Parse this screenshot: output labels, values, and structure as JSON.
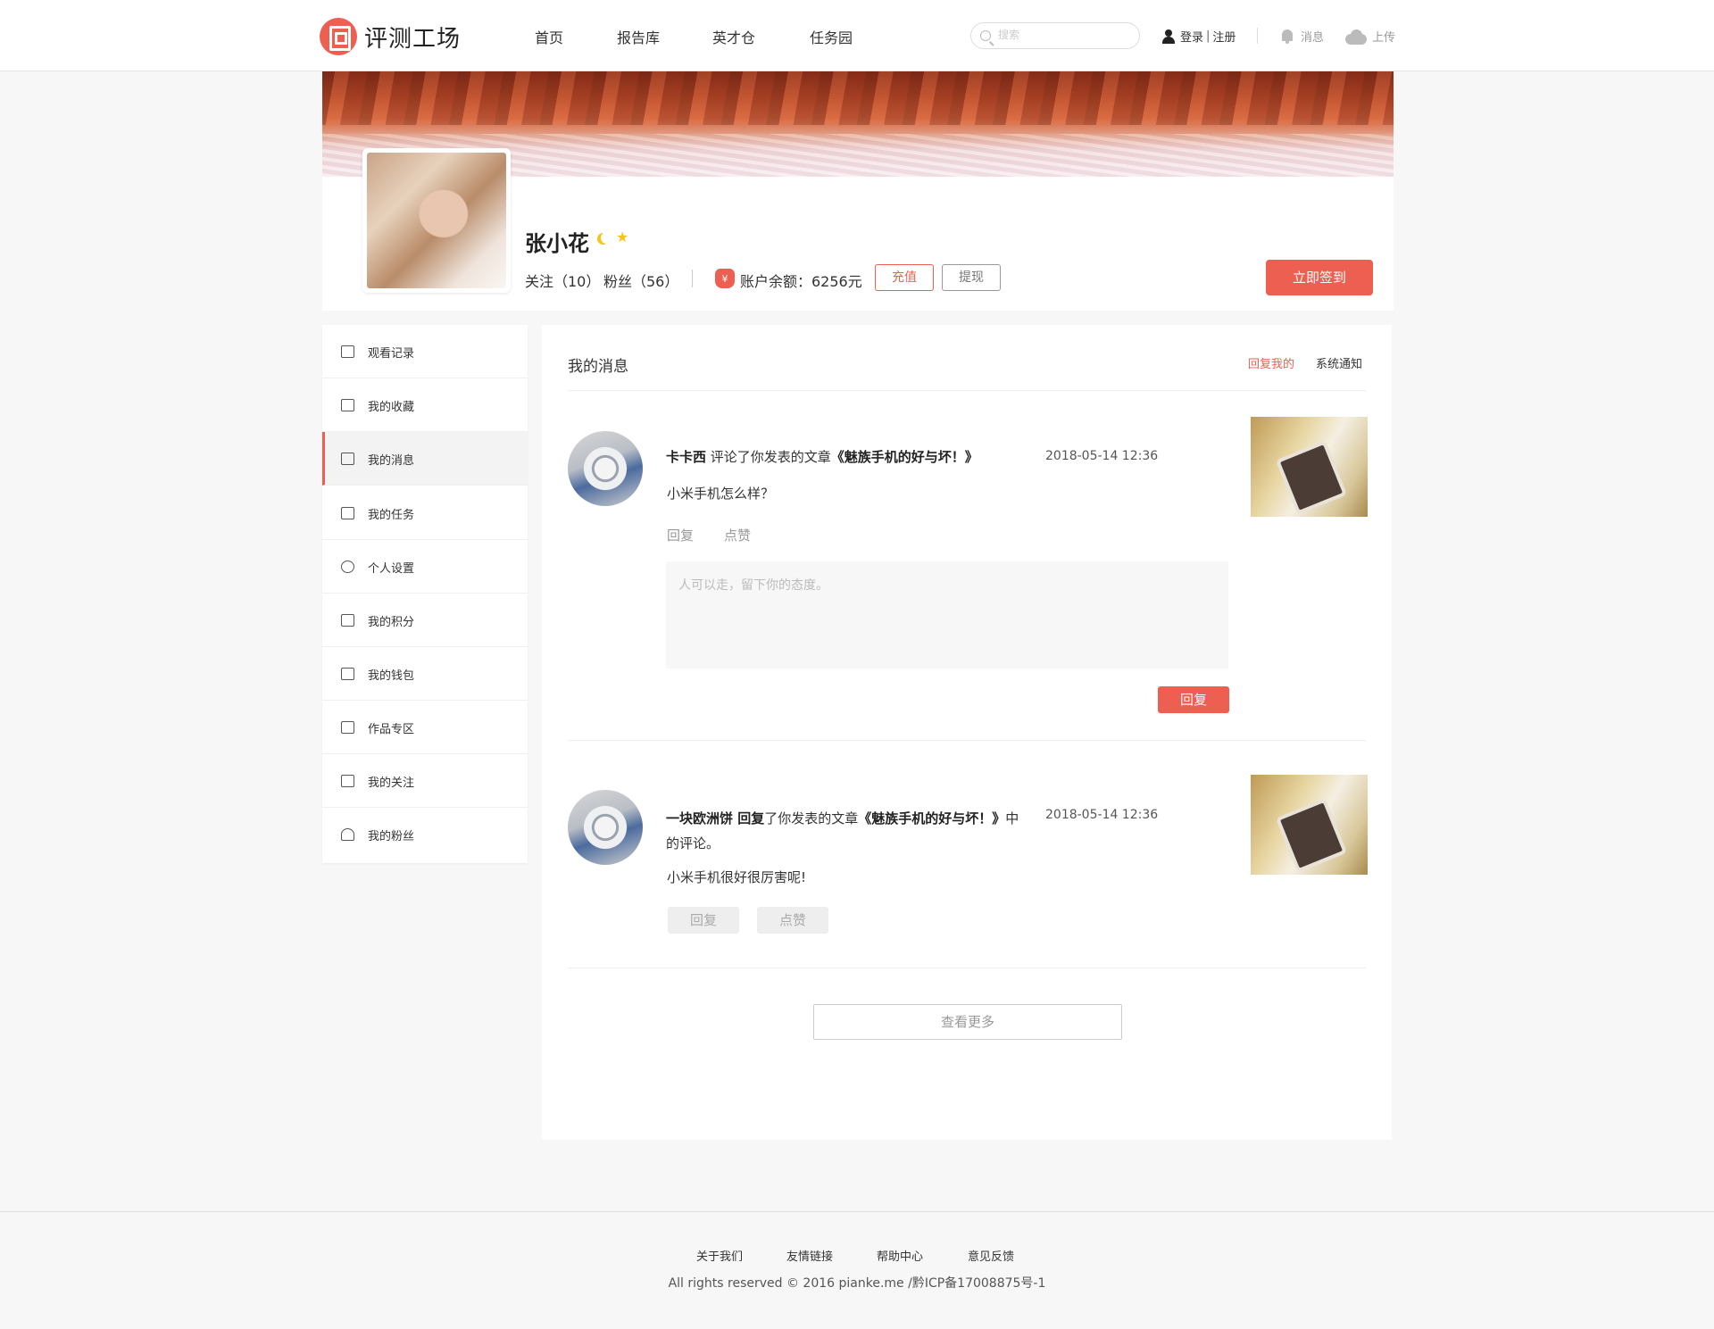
{
  "header": {
    "logo_text": "评测工场",
    "nav": [
      "首页",
      "报告库",
      "英才仓",
      "任务园"
    ],
    "search_placeholder": "搜索",
    "login": "登录",
    "register": "注册",
    "login_sep": "|",
    "messages": "消息",
    "upload": "上传"
  },
  "profile": {
    "name": "张小花",
    "following": "关注（10）",
    "fans": "粉丝（56）",
    "balance": "账户余额：6256元",
    "bag_symbol": "¥",
    "recharge": "充值",
    "withdraw": "提现",
    "checkin": "立即签到"
  },
  "sidebar": {
    "items": [
      {
        "label": "观看记录",
        "icon": "play-record-icon"
      },
      {
        "label": "我的收藏",
        "icon": "favorite-icon"
      },
      {
        "label": "我的消息",
        "icon": "message-icon"
      },
      {
        "label": "我的任务",
        "icon": "task-icon"
      },
      {
        "label": "个人设置",
        "icon": "settings-icon"
      },
      {
        "label": "我的积分",
        "icon": "points-icon"
      },
      {
        "label": "我的钱包",
        "icon": "wallet-icon"
      },
      {
        "label": "作品专区",
        "icon": "works-icon"
      },
      {
        "label": "我的关注",
        "icon": "follow-icon"
      },
      {
        "label": "我的粉丝",
        "icon": "fans-icon"
      }
    ],
    "active_index": 2
  },
  "main": {
    "title": "我的消息",
    "tabs": {
      "reply": "回复我的",
      "notice": "系统通知"
    },
    "messages": [
      {
        "author": "卡卡西",
        "action": " 评论了你发表的文章",
        "article": "《魅族手机的好与坏！》",
        "time": "2018-05-14 12:36",
        "body": "小米手机怎么样？",
        "reply_link": "回复",
        "like_link": "点赞",
        "reply_placeholder": "人可以走，留下你的态度。",
        "reply_button": "回复"
      },
      {
        "author": "一块欧洲饼 回复",
        "action": "了你发表的文章",
        "article": "《魅族手机的好与坏！》",
        "action2": "中的评论。",
        "time": "2018-05-14 12:36",
        "body": "小米手机很好很厉害呢!",
        "reply_button": "回复",
        "like_button": "点赞"
      }
    ],
    "more": "查看更多"
  },
  "footer": {
    "links": [
      "关于我们",
      "友情链接",
      "帮助中心",
      "意见反馈"
    ],
    "copyright": "All rights reserved © 2016 pianke.me /黔ICP备17008875号-1"
  },
  "colors": {
    "accent": "#ec5f51",
    "background": "#f7f7f7"
  }
}
